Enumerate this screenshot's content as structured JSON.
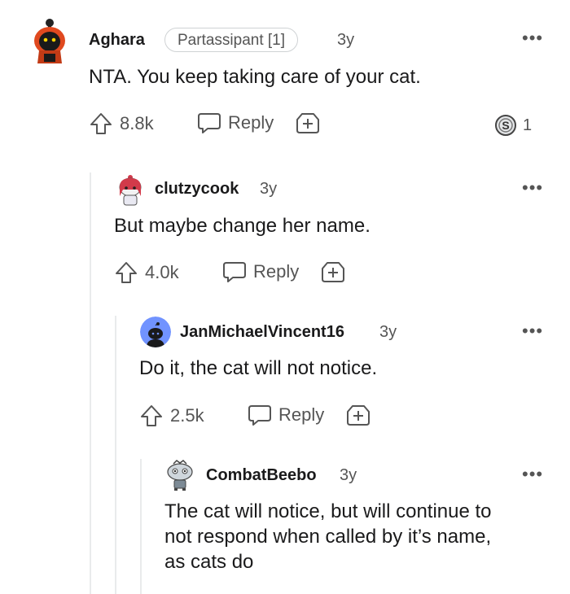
{
  "comments": [
    {
      "username": "Aghara",
      "flair": "Partassipant [1]",
      "age": "3y",
      "body": "NTA. You keep taking care of your cat.",
      "score": "8.8k",
      "reply_label": "Reply",
      "award_count": "1",
      "more": "•••"
    },
    {
      "username": "clutzycook",
      "age": "3y",
      "body": "But maybe change her name.",
      "score": "4.0k",
      "reply_label": "Reply",
      "more": "•••"
    },
    {
      "username": "JanMichaelVincent16",
      "age": "3y",
      "body": "Do it, the cat will not notice.",
      "score": "2.5k",
      "reply_label": "Reply",
      "more": "•••"
    },
    {
      "username": "CombatBeebo",
      "age": "3y",
      "body_lines": [
        "The cat will notice, but will continue to",
        "not respond when called by it’s name,",
        "as cats do"
      ],
      "more": "•••"
    }
  ],
  "icons": {
    "upvote": "upvote-arrow-icon",
    "reply": "speech-bubble-icon",
    "award": "plus-award-icon",
    "silver": "silver-award-icon"
  },
  "colors": {
    "text": "#1a1a1b",
    "muted": "#555555",
    "thread_line": "#e9ebec",
    "jan_avatar": "#7193ff",
    "aghara_avatar": "#e0491f"
  }
}
